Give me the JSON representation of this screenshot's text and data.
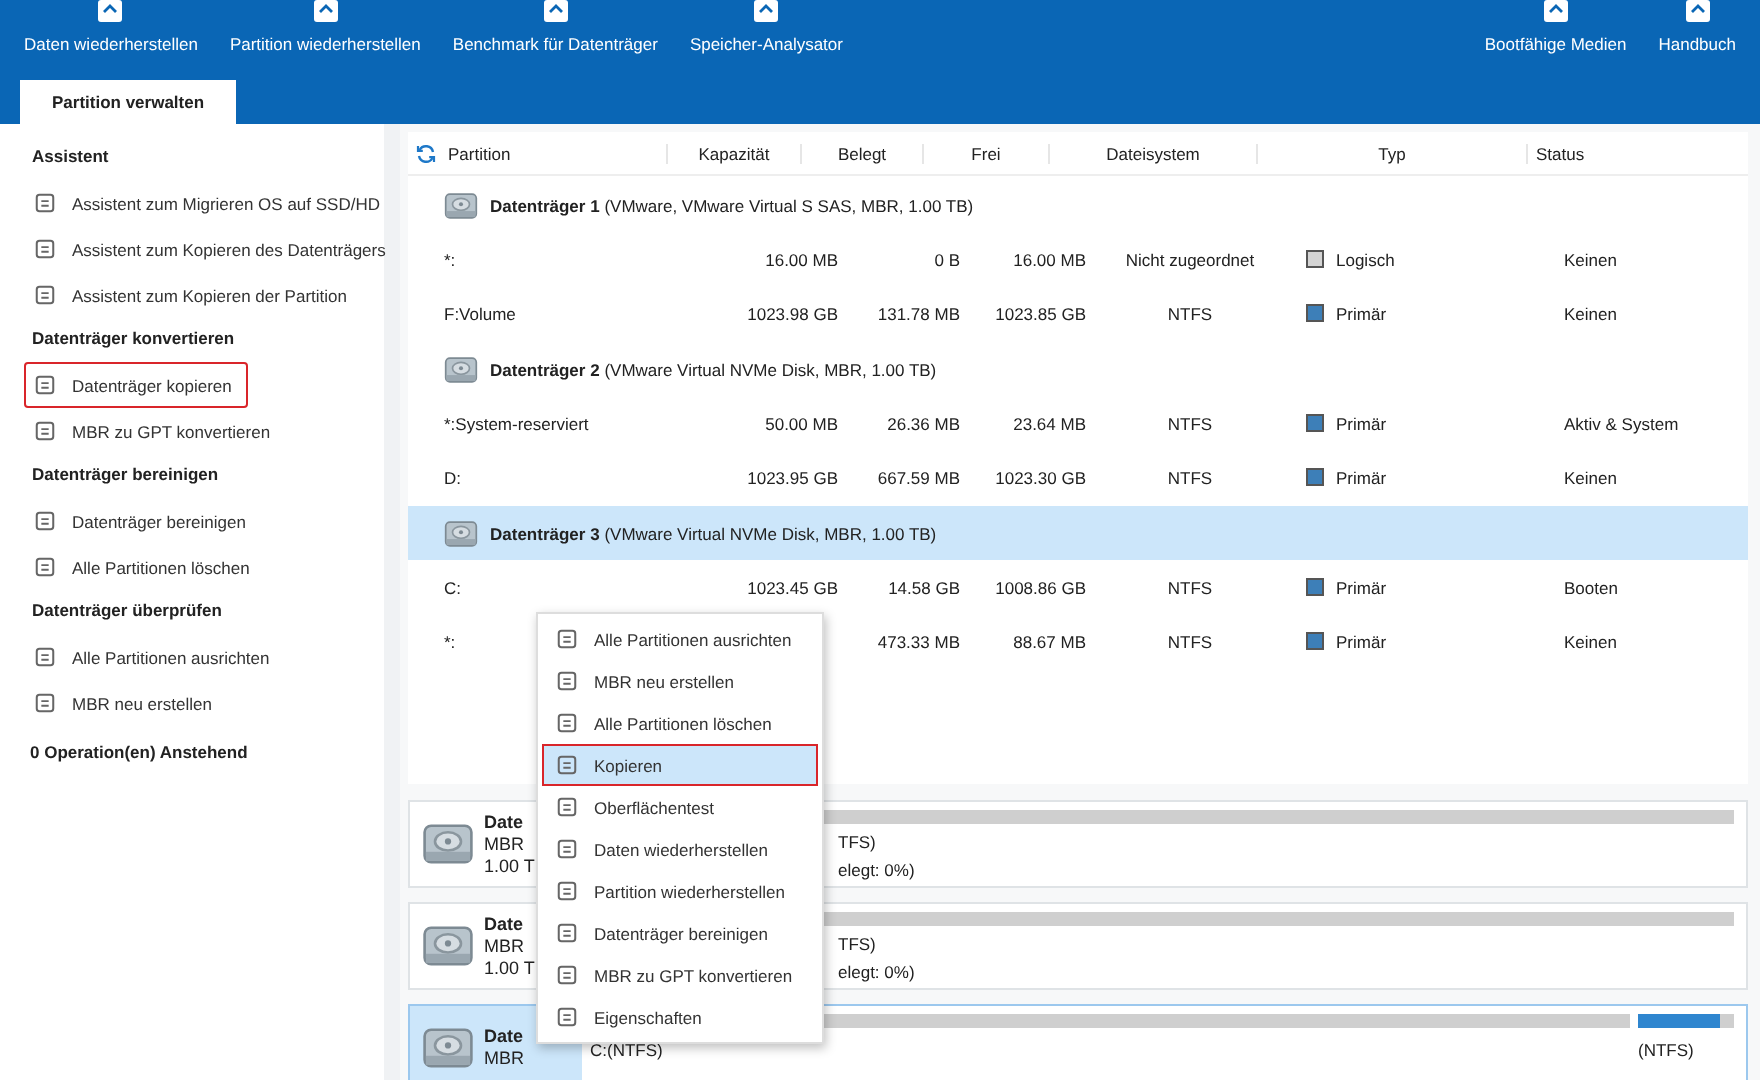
{
  "toolbar": {
    "left": [
      {
        "label": "Daten wiederherstellen"
      },
      {
        "label": "Partition wiederherstellen"
      },
      {
        "label": "Benchmark für Datenträger"
      },
      {
        "label": "Speicher-Analysator"
      }
    ],
    "right": [
      {
        "label": "Bootfähige Medien"
      },
      {
        "label": "Handbuch"
      }
    ]
  },
  "tabs": [
    {
      "label": "Partition verwalten",
      "selected": true
    }
  ],
  "sidebar": {
    "sections": [
      {
        "title": "Assistent",
        "items": [
          {
            "label": "Assistent zum Migrieren OS auf SSD/HD",
            "highlighted": false
          },
          {
            "label": "Assistent zum Kopieren des Datenträgers",
            "highlighted": false
          },
          {
            "label": "Assistent zum Kopieren der Partition",
            "highlighted": false
          }
        ]
      },
      {
        "title": "Datenträger konvertieren",
        "items": [
          {
            "label": "Datenträger kopieren",
            "highlighted": true
          },
          {
            "label": "MBR zu GPT konvertieren",
            "highlighted": false
          }
        ]
      },
      {
        "title": "Datenträger bereinigen",
        "items": [
          {
            "label": "Datenträger bereinigen",
            "highlighted": false
          },
          {
            "label": "Alle Partitionen löschen",
            "highlighted": false
          }
        ]
      },
      {
        "title": "Datenträger überprüfen",
        "items": [
          {
            "label": "Alle Partitionen ausrichten",
            "highlighted": false
          },
          {
            "label": "MBR neu erstellen",
            "highlighted": false
          }
        ]
      }
    ],
    "pending": "0 Operation(en) Anstehend"
  },
  "table": {
    "columns": [
      "Partition",
      "Kapazität",
      "Belegt",
      "Frei",
      "Dateisystem",
      "Typ",
      "Status"
    ],
    "rows": [
      {
        "kind": "disk",
        "name": "Datenträger 1",
        "detail": "(VMware, VMware Virtual S SAS, MBR, 1.00 TB)",
        "selected": false
      },
      {
        "kind": "partition",
        "cells": [
          "*:",
          "16.00 MB",
          "0 B",
          "16.00 MB",
          "Nicht zugeordnet",
          "Logisch",
          "Keinen"
        ],
        "color": "#d4d4d4"
      },
      {
        "kind": "partition",
        "cells": [
          "F:Volume",
          "1023.98 GB",
          "131.78 MB",
          "1023.85 GB",
          "NTFS",
          "Primär",
          "Keinen"
        ],
        "color": "#3d7fb8"
      },
      {
        "kind": "disk",
        "name": "Datenträger 2",
        "detail": "(VMware Virtual NVMe Disk, MBR, 1.00 TB)",
        "selected": false
      },
      {
        "kind": "partition",
        "cells": [
          "*:System-reserviert",
          "50.00 MB",
          "26.36 MB",
          "23.64 MB",
          "NTFS",
          "Primär",
          "Aktiv & System"
        ],
        "color": "#3d7fb8"
      },
      {
        "kind": "partition",
        "cells": [
          "D:",
          "1023.95 GB",
          "667.59 MB",
          "1023.30 GB",
          "NTFS",
          "Primär",
          "Keinen"
        ],
        "color": "#3d7fb8"
      },
      {
        "kind": "disk",
        "name": "Datenträger 3",
        "detail": "(VMware Virtual NVMe Disk, MBR, 1.00 TB)",
        "selected": true
      },
      {
        "kind": "partition",
        "cells": [
          "C:",
          "1023.45 GB",
          "14.58 GB",
          "1008.86 GB",
          "NTFS",
          "Primär",
          "Booten"
        ],
        "color": "#3d7fb8"
      },
      {
        "kind": "partition",
        "cells": [
          "*:",
          "",
          "473.33 MB",
          "88.67 MB",
          "NTFS",
          "Primär",
          "Keinen"
        ],
        "color": "#3d7fb8"
      }
    ]
  },
  "disk_cards": [
    {
      "name": "Date",
      "type": "MBR",
      "size": "1.00 T",
      "selected": false,
      "segments": [
        {
          "label": "TFS)",
          "detail": "elegt: 0%)",
          "hidden_start": true
        }
      ]
    },
    {
      "name": "Date",
      "type": "MBR",
      "size": "1.00 T",
      "selected": false,
      "segments": [
        {
          "label": "TFS)",
          "detail": "elegt: 0%)",
          "hidden_start": true
        }
      ]
    },
    {
      "name": "Date",
      "type": "MBR",
      "selected": true,
      "segments": [
        {
          "label": "C:(NTFS)",
          "hidden_start": false
        },
        {
          "label": "(NTFS)",
          "level": 0.85,
          "hidden_start": false
        }
      ]
    }
  ],
  "context_menu": {
    "items": [
      {
        "label": "Alle Partitionen ausrichten",
        "selected": false
      },
      {
        "label": "MBR neu erstellen",
        "selected": false
      },
      {
        "label": "Alle Partitionen löschen",
        "selected": false
      },
      {
        "label": "Kopieren",
        "selected": true
      },
      {
        "label": "Oberflächentest",
        "selected": false
      },
      {
        "label": "Daten wiederherstellen",
        "selected": false
      },
      {
        "label": "Partition wiederherstellen",
        "selected": false
      },
      {
        "label": "Datenträger bereinigen",
        "selected": false
      },
      {
        "label": "MBR zu GPT konvertieren",
        "selected": false
      },
      {
        "label": "Eigenschaften",
        "selected": false
      }
    ]
  }
}
